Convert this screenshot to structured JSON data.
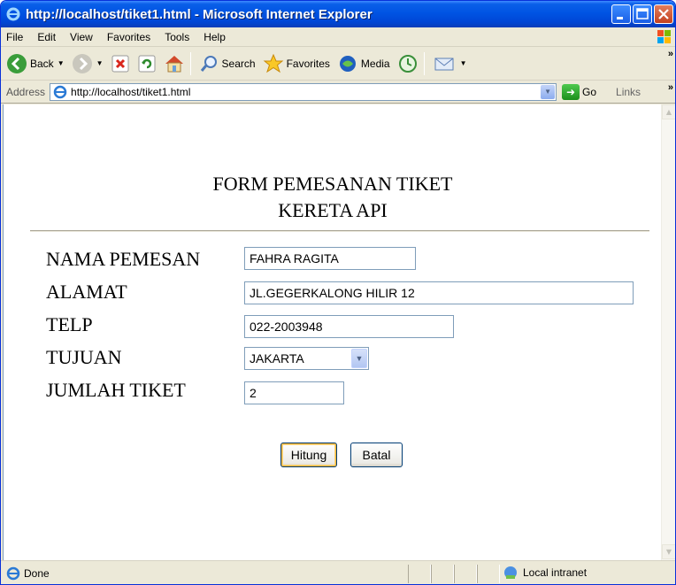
{
  "window": {
    "title": "http://localhost/tiket1.html - Microsoft Internet Explorer"
  },
  "menu": {
    "items": [
      "File",
      "Edit",
      "View",
      "Favorites",
      "Tools",
      "Help"
    ]
  },
  "toolbar": {
    "back_label": "Back",
    "search_label": "Search",
    "favorites_label": "Favorites",
    "media_label": "Media"
  },
  "address": {
    "label": "Address",
    "url": "http://localhost/tiket1.html",
    "go_label": "Go",
    "links_label": "Links"
  },
  "form": {
    "title_line1": "FORM PEMESANAN TIKET",
    "title_line2": "KERETA API",
    "nama_label": "NAMA PEMESAN",
    "nama_value": "FAHRA RAGITA",
    "alamat_label": "ALAMAT",
    "alamat_value": "JL.GEGERKALONG HILIR 12",
    "telp_label": "TELP",
    "telp_value": "022-2003948",
    "tujuan_label": "TUJUAN",
    "tujuan_value": "JAKARTA",
    "jumlah_label": "JUMLAH TIKET",
    "jumlah_value": "2",
    "hitung_label": "Hitung",
    "batal_label": "Batal"
  },
  "status": {
    "text": "Done",
    "zone": "Local intranet"
  },
  "colors": {
    "titlebar": "#0054e3",
    "chrome": "#ece9d8",
    "input_border": "#7f9db9"
  },
  "icons": [
    "ie-icon",
    "back-icon",
    "forward-icon",
    "stop-icon",
    "refresh-icon",
    "home-icon",
    "search-icon",
    "favorites-icon",
    "media-icon",
    "history-icon",
    "mail-icon",
    "go-icon",
    "windows-logo-icon",
    "intranet-icon"
  ]
}
